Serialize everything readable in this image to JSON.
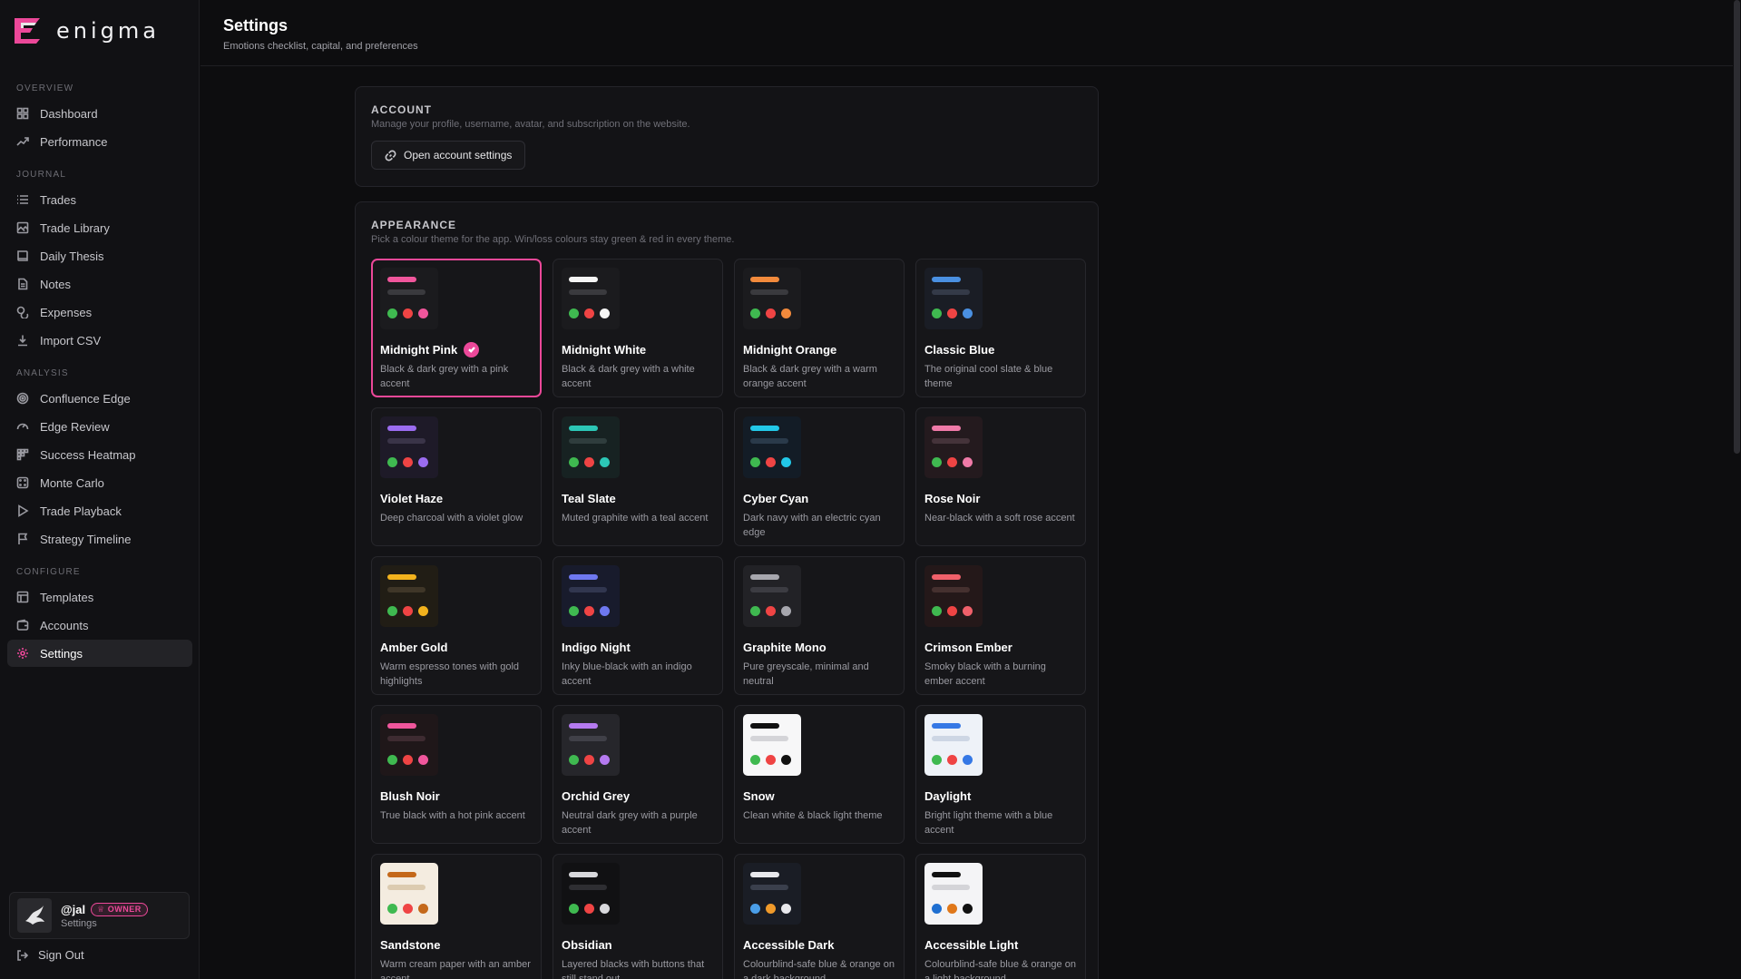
{
  "app": {
    "name": "enigma",
    "accent": "#ec4899"
  },
  "header": {
    "title": "Settings",
    "subtitle": "Emotions checklist, capital, and preferences"
  },
  "sidebar": {
    "sections": [
      {
        "label": "OVERVIEW",
        "items": [
          {
            "label": "Dashboard",
            "icon": "grid-icon"
          },
          {
            "label": "Performance",
            "icon": "trend-icon"
          }
        ]
      },
      {
        "label": "JOURNAL",
        "items": [
          {
            "label": "Trades",
            "icon": "list-icon"
          },
          {
            "label": "Trade Library",
            "icon": "image-icon"
          },
          {
            "label": "Daily Thesis",
            "icon": "book-icon"
          },
          {
            "label": "Notes",
            "icon": "file-icon"
          },
          {
            "label": "Expenses",
            "icon": "coins-icon"
          },
          {
            "label": "Import CSV",
            "icon": "download-icon"
          }
        ]
      },
      {
        "label": "ANALYSIS",
        "items": [
          {
            "label": "Confluence Edge",
            "icon": "target-icon"
          },
          {
            "label": "Edge Review",
            "icon": "gauge-icon"
          },
          {
            "label": "Success Heatmap",
            "icon": "heatmap-icon"
          },
          {
            "label": "Monte Carlo",
            "icon": "dice-icon"
          },
          {
            "label": "Trade Playback",
            "icon": "play-icon"
          },
          {
            "label": "Strategy Timeline",
            "icon": "flag-icon"
          }
        ]
      },
      {
        "label": "CONFIGURE",
        "items": [
          {
            "label": "Templates",
            "icon": "layout-icon"
          },
          {
            "label": "Accounts",
            "icon": "wallet-icon"
          },
          {
            "label": "Settings",
            "icon": "gear-icon",
            "active": true
          }
        ]
      }
    ],
    "user": {
      "name": "@jal",
      "badge": "OWNER",
      "sub": "Settings"
    },
    "signout": "Sign Out"
  },
  "account": {
    "title": "ACCOUNT",
    "desc": "Manage your profile, username, avatar, and subscription on the website.",
    "button": "Open account settings"
  },
  "appearance": {
    "title": "APPEARANCE",
    "desc": "Pick a colour theme for the app. Win/loss colours stay green & red in every theme.",
    "themes": [
      {
        "name": "Midnight Pink",
        "desc": "Black & dark grey with a pink accent",
        "selected": true,
        "bg": "#1b1b1e",
        "bar1": "#f0569c",
        "bar2": "#3a3a3e",
        "dots": [
          "#3fb950",
          "#ef4444",
          "#f0569c"
        ]
      },
      {
        "name": "Midnight White",
        "desc": "Black & dark grey with a white accent",
        "bg": "#1b1b1e",
        "bar1": "#f5f5f5",
        "bar2": "#3a3a3e",
        "dots": [
          "#3fb950",
          "#ef4444",
          "#f5f5f5"
        ]
      },
      {
        "name": "Midnight Orange",
        "desc": "Black & dark grey with a warm orange accent",
        "bg": "#1b1b1e",
        "bar1": "#f28a3c",
        "bar2": "#3a3a3e",
        "dots": [
          "#3fb950",
          "#ef4444",
          "#f28a3c"
        ]
      },
      {
        "name": "Classic Blue",
        "desc": "The original cool slate & blue theme",
        "bg": "#1a1d25",
        "bar1": "#4a90e2",
        "bar2": "#343a48",
        "dots": [
          "#3fb950",
          "#ef4444",
          "#4a90e2"
        ]
      },
      {
        "name": "Violet Haze",
        "desc": "Deep charcoal with a violet glow",
        "bg": "#1e1a28",
        "bar1": "#9b6cf0",
        "bar2": "#3a3448",
        "dots": [
          "#3fb950",
          "#ef4444",
          "#9b6cf0"
        ]
      },
      {
        "name": "Teal Slate",
        "desc": "Muted graphite with a teal accent",
        "bg": "#172222",
        "bar1": "#2cc7b6",
        "bar2": "#2f3d3d",
        "dots": [
          "#3fb950",
          "#ef4444",
          "#2cc7b6"
        ]
      },
      {
        "name": "Cyber Cyan",
        "desc": "Dark navy with an electric cyan edge",
        "bg": "#131c26",
        "bar1": "#22c8e8",
        "bar2": "#2a3a4a",
        "dots": [
          "#3fb950",
          "#ef4444",
          "#22c8e8"
        ]
      },
      {
        "name": "Rose Noir",
        "desc": "Near-black with a soft rose accent",
        "bg": "#241a1e",
        "bar1": "#f07aa8",
        "bar2": "#45333a",
        "dots": [
          "#3fb950",
          "#ef4444",
          "#f07aa8"
        ]
      },
      {
        "name": "Amber Gold",
        "desc": "Warm espresso tones with gold highlights",
        "bg": "#211d15",
        "bar1": "#f2b21d",
        "bar2": "#3f3628",
        "dots": [
          "#3fb950",
          "#ef4444",
          "#f2b21d"
        ]
      },
      {
        "name": "Indigo Night",
        "desc": "Inky blue-black with an indigo accent",
        "bg": "#181b2c",
        "bar1": "#6e78f0",
        "bar2": "#31364f",
        "dots": [
          "#3fb950",
          "#ef4444",
          "#6e78f0"
        ]
      },
      {
        "name": "Graphite Mono",
        "desc": "Pure greyscale, minimal and neutral",
        "bg": "#222226",
        "bar1": "#a7a7ae",
        "bar2": "#3c3c42",
        "dots": [
          "#3fb950",
          "#ef4444",
          "#a7a7ae"
        ]
      },
      {
        "name": "Crimson Ember",
        "desc": "Smoky black with a burning ember accent",
        "bg": "#241819",
        "bar1": "#f0606a",
        "bar2": "#45302f",
        "dots": [
          "#3fb950",
          "#ef4444",
          "#f0606a"
        ]
      },
      {
        "name": "Blush Noir",
        "desc": "True black with a hot pink accent",
        "bg": "#1f1719",
        "bar1": "#f0569c",
        "bar2": "#3e2b31",
        "dots": [
          "#3fb950",
          "#ef4444",
          "#f0569c"
        ]
      },
      {
        "name": "Orchid Grey",
        "desc": "Neutral dark grey with a purple accent",
        "bg": "#26262b",
        "bar1": "#b57af0",
        "bar2": "#404048",
        "dots": [
          "#3fb950",
          "#ef4444",
          "#b57af0"
        ]
      },
      {
        "name": "Snow",
        "desc": "Clean white & black light theme",
        "bg": "#f7f7f8",
        "bar1": "#111111",
        "bar2": "#d4d4d8",
        "dots": [
          "#3fb950",
          "#ef4444",
          "#111111"
        ]
      },
      {
        "name": "Daylight",
        "desc": "Bright light theme with a blue accent",
        "bg": "#eef2f8",
        "bar1": "#3578e5",
        "bar2": "#cdd6e4",
        "dots": [
          "#3fb950",
          "#ef4444",
          "#3578e5"
        ]
      },
      {
        "name": "Sandstone",
        "desc": "Warm cream paper with an amber accent",
        "bg": "#f4ece0",
        "bar1": "#c4681a",
        "bar2": "#dccbb0",
        "dots": [
          "#3fb950",
          "#ef4444",
          "#c4681a"
        ]
      },
      {
        "name": "Obsidian",
        "desc": "Layered blacks with buttons that still stand out",
        "bg": "#111113",
        "bar1": "#d8d8dc",
        "bar2": "#2e2e32",
        "dots": [
          "#3fb950",
          "#ef4444",
          "#d8d8dc"
        ]
      },
      {
        "name": "Accessible Dark",
        "desc": "Colourblind-safe blue & orange on a dark background",
        "bg": "#1a1d25",
        "bar1": "#e8e8ec",
        "bar2": "#3a3f4c",
        "dots": [
          "#4a9ee8",
          "#f09a2a",
          "#e8e8ec"
        ]
      },
      {
        "name": "Accessible Light",
        "desc": "Colourblind-safe blue & orange on a light background",
        "bg": "#f4f4f6",
        "bar1": "#111111",
        "bar2": "#d4d4d8",
        "dots": [
          "#1f6fd1",
          "#e0781a",
          "#111111"
        ]
      }
    ]
  }
}
